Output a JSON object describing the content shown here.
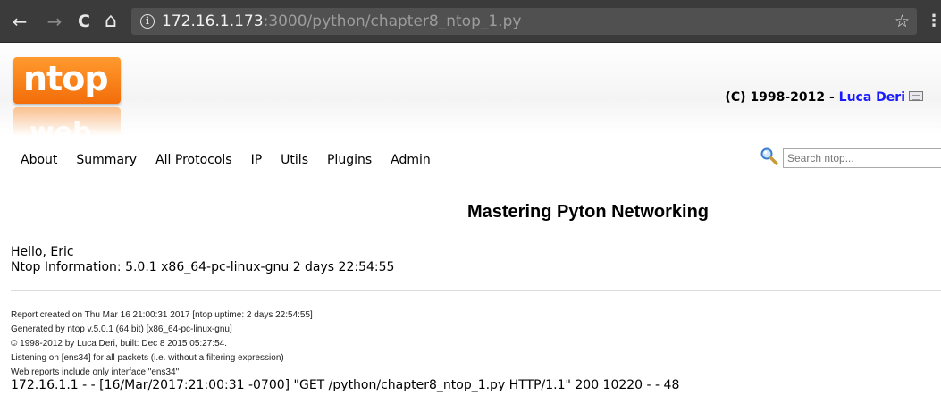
{
  "browser": {
    "back_glyph": "←",
    "forward_glyph": "→",
    "reload_glyph": "C",
    "home_glyph": "⌂",
    "info_glyph": "i",
    "url_host": "172.16.1.173",
    "url_rest": ":3000/python/chapter8_ntop_1.py",
    "star_glyph": "☆",
    "menu_glyph": "⋮"
  },
  "header": {
    "logo_text": "ntop",
    "logo_reflection_text": "web",
    "copyright_prefix": "(C) 1998-2012 - ",
    "copyright_author": "Luca Deri",
    "logo_color": "#f47b12",
    "author_color": "#1a1aff"
  },
  "menu": {
    "items": [
      "About",
      "Summary",
      "All Protocols",
      "IP",
      "Utils",
      "Plugins",
      "Admin"
    ]
  },
  "search": {
    "placeholder": "Search ntop..."
  },
  "main": {
    "title": "Mastering Pyton Networking",
    "greeting": "Hello, Eric",
    "info": "Ntop Information: 5.0.1 x86_64-pc-linux-gnu 2 days 22:54:55"
  },
  "report": {
    "lines": [
      "Report created on Thu Mar 16 21:00:31 2017 [ntop uptime: 2 days 22:54:55]",
      "Generated by ntop v.5.0.1 (64 bit) [x86_64-pc-linux-gnu]",
      "© 1998-2012 by Luca Deri, built: Dec 8 2015 05:27:54.",
      "Listening on [ens34] for all packets (i.e. without a filtering expression)",
      "Web reports include only interface \"ens34\""
    ]
  },
  "log": {
    "line": "172.16.1.1 - - [16/Mar/2017:21:00:31 -0700] \"GET /python/chapter8_ntop_1.py HTTP/1.1\" 200 10220 - - 48"
  }
}
